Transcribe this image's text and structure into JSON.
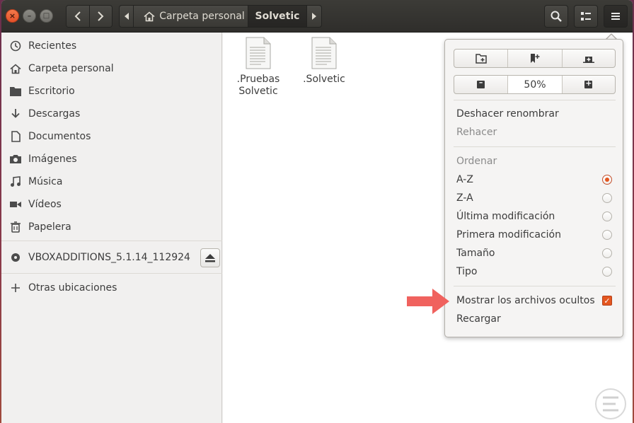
{
  "window": {
    "controls": {
      "close": "×",
      "minimize": "–",
      "maximize": "□"
    }
  },
  "headerbar": {
    "nav_back_icon": "chevron-left-icon",
    "nav_forward_icon": "chevron-right-icon",
    "path": {
      "home_label": "Carpeta personal",
      "current_label": "Solvetic"
    },
    "search_icon": "search-icon",
    "view_icon": "view-toggle-icon",
    "menu_icon": "hamburger-menu-icon"
  },
  "sidebar": {
    "items": [
      {
        "label": "Recientes",
        "icon": "clock-icon"
      },
      {
        "label": "Carpeta personal",
        "icon": "home-icon"
      },
      {
        "label": "Escritorio",
        "icon": "folder-icon"
      },
      {
        "label": "Descargas",
        "icon": "download-icon"
      },
      {
        "label": "Documentos",
        "icon": "document-icon"
      },
      {
        "label": "Imágenes",
        "icon": "camera-icon"
      },
      {
        "label": "Música",
        "icon": "music-icon"
      },
      {
        "label": "Vídeos",
        "icon": "video-icon"
      },
      {
        "label": "Papelera",
        "icon": "trash-icon"
      }
    ],
    "device": {
      "label": "VBOXADDITIONS_5.1.14_112924",
      "icon": "disc-icon",
      "eject_icon": "eject-icon"
    },
    "other": {
      "label": "Otras ubicaciones",
      "icon": "plus-icon"
    }
  },
  "files": [
    {
      "name": ".Pruebas\nSolvetic",
      "icon": "text-file-icon"
    },
    {
      "name": ".Solvetic",
      "icon": "text-file-icon"
    }
  ],
  "menu": {
    "top_buttons": [
      "new-folder-icon",
      "bookmark-add-icon",
      "new-tab-icon"
    ],
    "zoom": {
      "minus": "–",
      "value": "50%",
      "plus": "+"
    },
    "undo": "Deshacer renombrar",
    "redo": "Rehacer",
    "sort_heading": "Ordenar",
    "sort_options": [
      {
        "label": "A-Z",
        "selected": true
      },
      {
        "label": "Z-A",
        "selected": false
      },
      {
        "label": "Última modificación",
        "selected": false
      },
      {
        "label": "Primera modificación",
        "selected": false
      },
      {
        "label": "Tamaño",
        "selected": false
      },
      {
        "label": "Tipo",
        "selected": false
      }
    ],
    "show_hidden": {
      "label": "Mostrar los archivos ocultos",
      "checked": true
    },
    "reload": "Recargar"
  },
  "colors": {
    "accent": "#e4561f",
    "annotation_arrow": "#f0625e",
    "headerbar": "#3c3b37"
  }
}
